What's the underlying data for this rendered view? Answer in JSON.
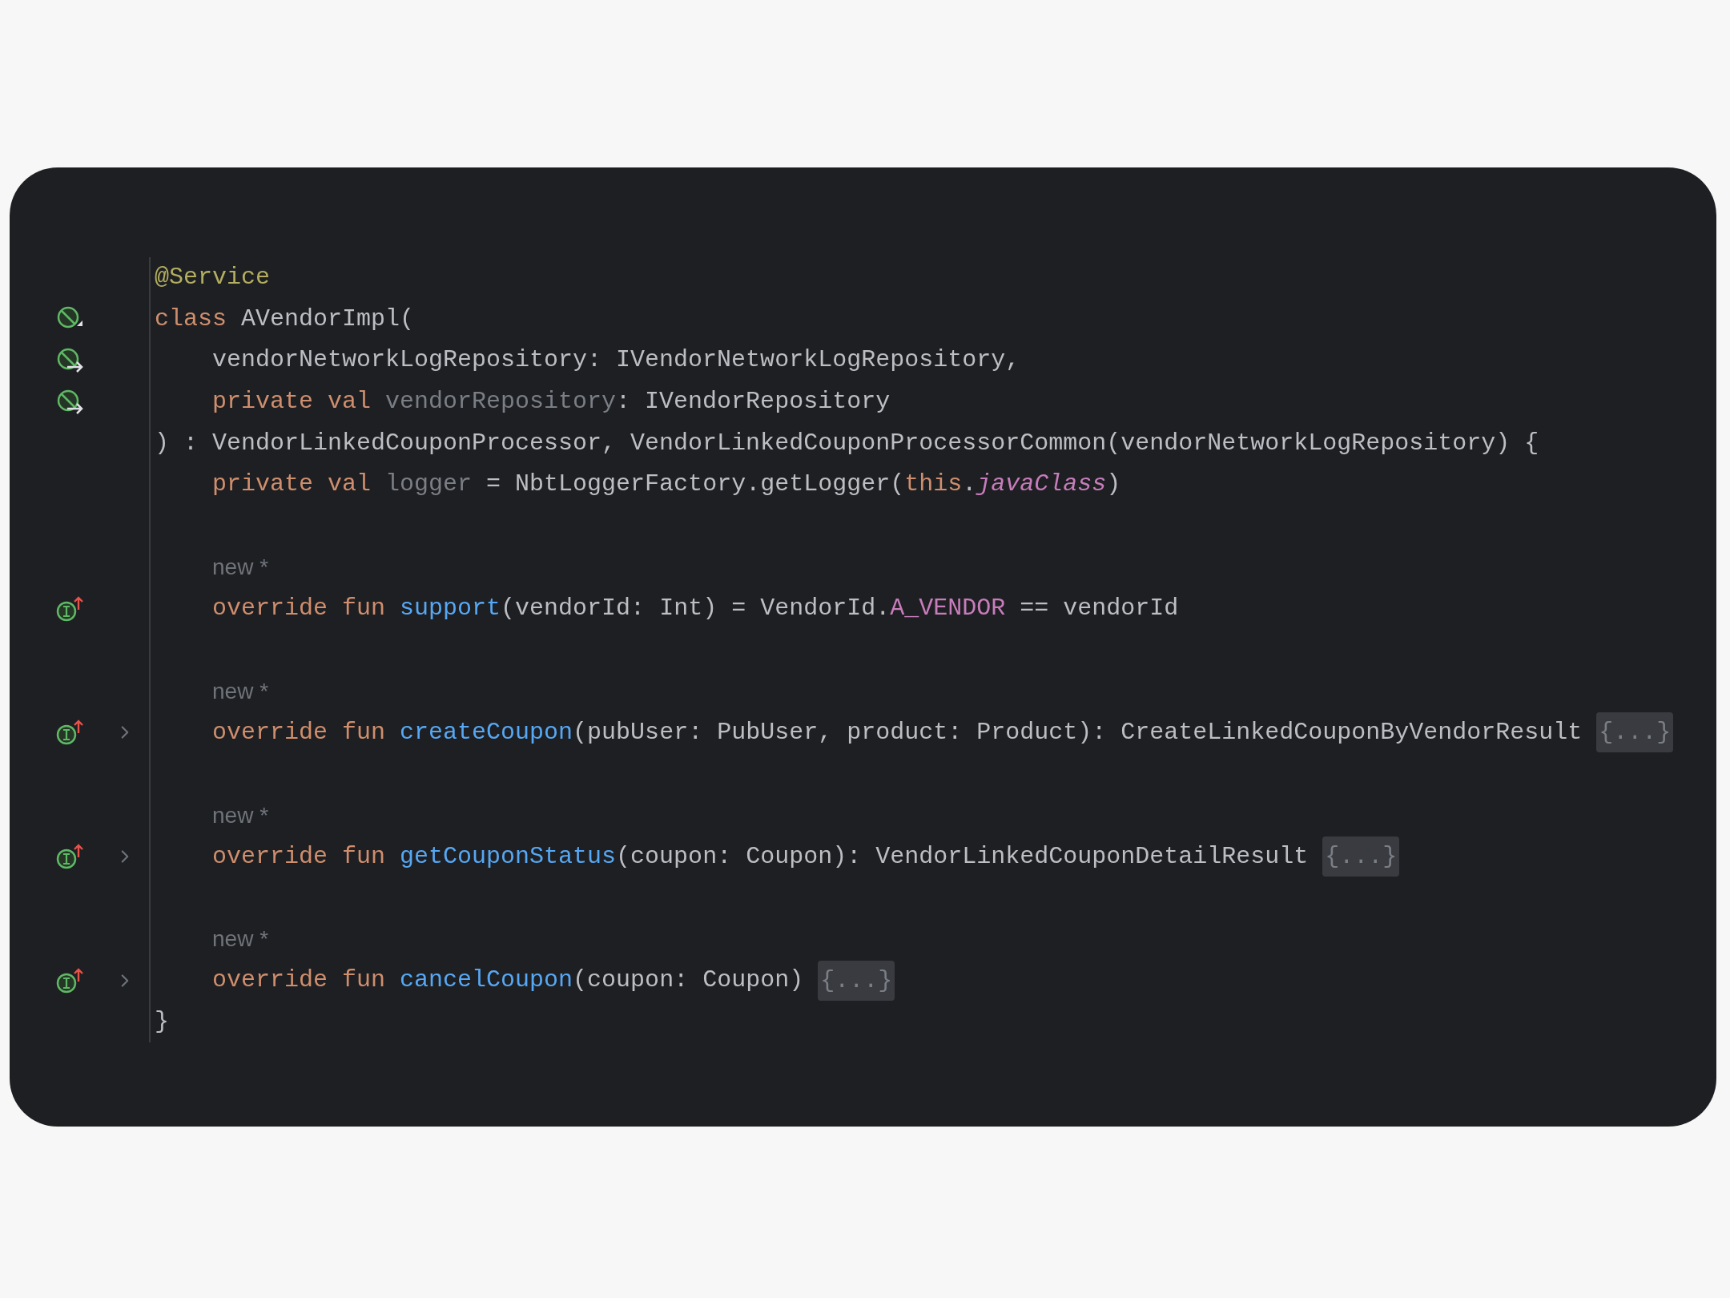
{
  "editor": {
    "lines": [
      {
        "kind": "code",
        "segments": [
          {
            "text": "@Service",
            "kind": "annotation"
          }
        ]
      },
      {
        "kind": "code",
        "gutter": {
          "kind": "bean"
        },
        "segments": [
          {
            "text": "class ",
            "kind": "keyword"
          },
          {
            "text": "AVendorImpl(",
            "kind": "plain"
          }
        ]
      },
      {
        "kind": "code",
        "gutter": {
          "kind": "inject"
        },
        "segments": [
          {
            "text": "    vendorNetworkLogRepository: IVendorNetworkLogRepository,",
            "kind": "plain"
          }
        ]
      },
      {
        "kind": "code",
        "gutter": {
          "kind": "inject"
        },
        "segments": [
          {
            "text": "    private val ",
            "kind": "keyword"
          },
          {
            "text": "vendorRepository",
            "kind": "dim"
          },
          {
            "text": ": IVendorRepository",
            "kind": "plain"
          }
        ]
      },
      {
        "kind": "code",
        "segments": [
          {
            "text": ") : VendorLinkedCouponProcessor, VendorLinkedCouponProcessorCommon(vendorNetworkLogRepository) {",
            "kind": "plain"
          }
        ]
      },
      {
        "kind": "code",
        "segments": [
          {
            "text": "    private val ",
            "kind": "keyword"
          },
          {
            "text": "logger",
            "kind": "dim"
          },
          {
            "text": " = NbtLoggerFactory.getLogger(",
            "kind": "plain"
          },
          {
            "text": "this",
            "kind": "keyword"
          },
          {
            "text": ".",
            "kind": "plain"
          },
          {
            "text": "javaClass",
            "kind": "italic-member"
          },
          {
            "text": ")",
            "kind": "plain"
          }
        ]
      },
      {
        "kind": "blank"
      },
      {
        "kind": "hint",
        "text": "new *"
      },
      {
        "kind": "code",
        "gutter": {
          "kind": "implements"
        },
        "segments": [
          {
            "text": "    override fun ",
            "kind": "keyword"
          },
          {
            "text": "support",
            "kind": "function"
          },
          {
            "text": "(vendorId: Int) = VendorId.",
            "kind": "plain"
          },
          {
            "text": "A_VENDOR",
            "kind": "member"
          },
          {
            "text": " == vendorId",
            "kind": "plain"
          }
        ]
      },
      {
        "kind": "blank"
      },
      {
        "kind": "hint",
        "text": "new *"
      },
      {
        "kind": "code",
        "gutter": {
          "kind": "implements"
        },
        "fold": {
          "collapsed": true,
          "placeholder": "{...}"
        },
        "segments": [
          {
            "text": "    override fun ",
            "kind": "keyword"
          },
          {
            "text": "createCoupon",
            "kind": "function"
          },
          {
            "text": "(pubUser: PubUser, product: Product): CreateLinkedCouponByVendorResult",
            "kind": "plain"
          }
        ]
      },
      {
        "kind": "blank"
      },
      {
        "kind": "hint",
        "text": "new *"
      },
      {
        "kind": "code",
        "gutter": {
          "kind": "implements"
        },
        "fold": {
          "collapsed": true,
          "placeholder": "{...}"
        },
        "segments": [
          {
            "text": "    override fun ",
            "kind": "keyword"
          },
          {
            "text": "getCouponStatus",
            "kind": "function"
          },
          {
            "text": "(coupon: Coupon): VendorLinkedCouponDetailResult",
            "kind": "plain"
          }
        ]
      },
      {
        "kind": "blank"
      },
      {
        "kind": "hint",
        "text": "new *"
      },
      {
        "kind": "code",
        "gutter": {
          "kind": "implements"
        },
        "fold": {
          "collapsed": true,
          "placeholder": "{...}"
        },
        "segments": [
          {
            "text": "    override fun ",
            "kind": "keyword"
          },
          {
            "text": "cancelCoupon",
            "kind": "function"
          },
          {
            "text": "(coupon: Coupon)",
            "kind": "plain"
          }
        ]
      },
      {
        "kind": "code",
        "segments": [
          {
            "text": "}",
            "kind": "plain"
          }
        ]
      }
    ]
  }
}
